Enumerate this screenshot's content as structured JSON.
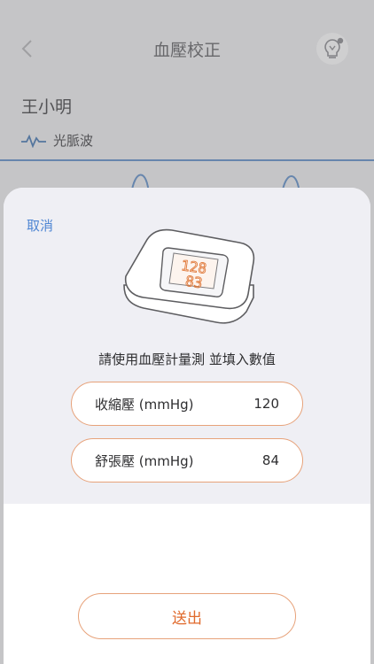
{
  "header": {
    "title": "血壓校正"
  },
  "profile": {
    "name": "王小明",
    "waveform_label": "光脈波"
  },
  "dialog": {
    "cancel_label": "取消",
    "device_display": {
      "systolic": "128",
      "diastolic": "83"
    },
    "instruction": "請使用血壓計量測 並填入數值",
    "fields": [
      {
        "label": "收縮壓 (mmHg)",
        "value": "120"
      },
      {
        "label": "舒張壓 (mmHg)",
        "value": "84"
      }
    ],
    "submit_label": "送出"
  },
  "colors": {
    "accent_orange": "#e06a2c",
    "field_border": "#e7a27a",
    "link_blue": "#4f86d3",
    "waveform_blue": "#5b7ea8"
  },
  "icons": {
    "back": "chevron-left-icon",
    "tip": "lightbulb-icon",
    "waveform": "pulse-wave-icon"
  }
}
